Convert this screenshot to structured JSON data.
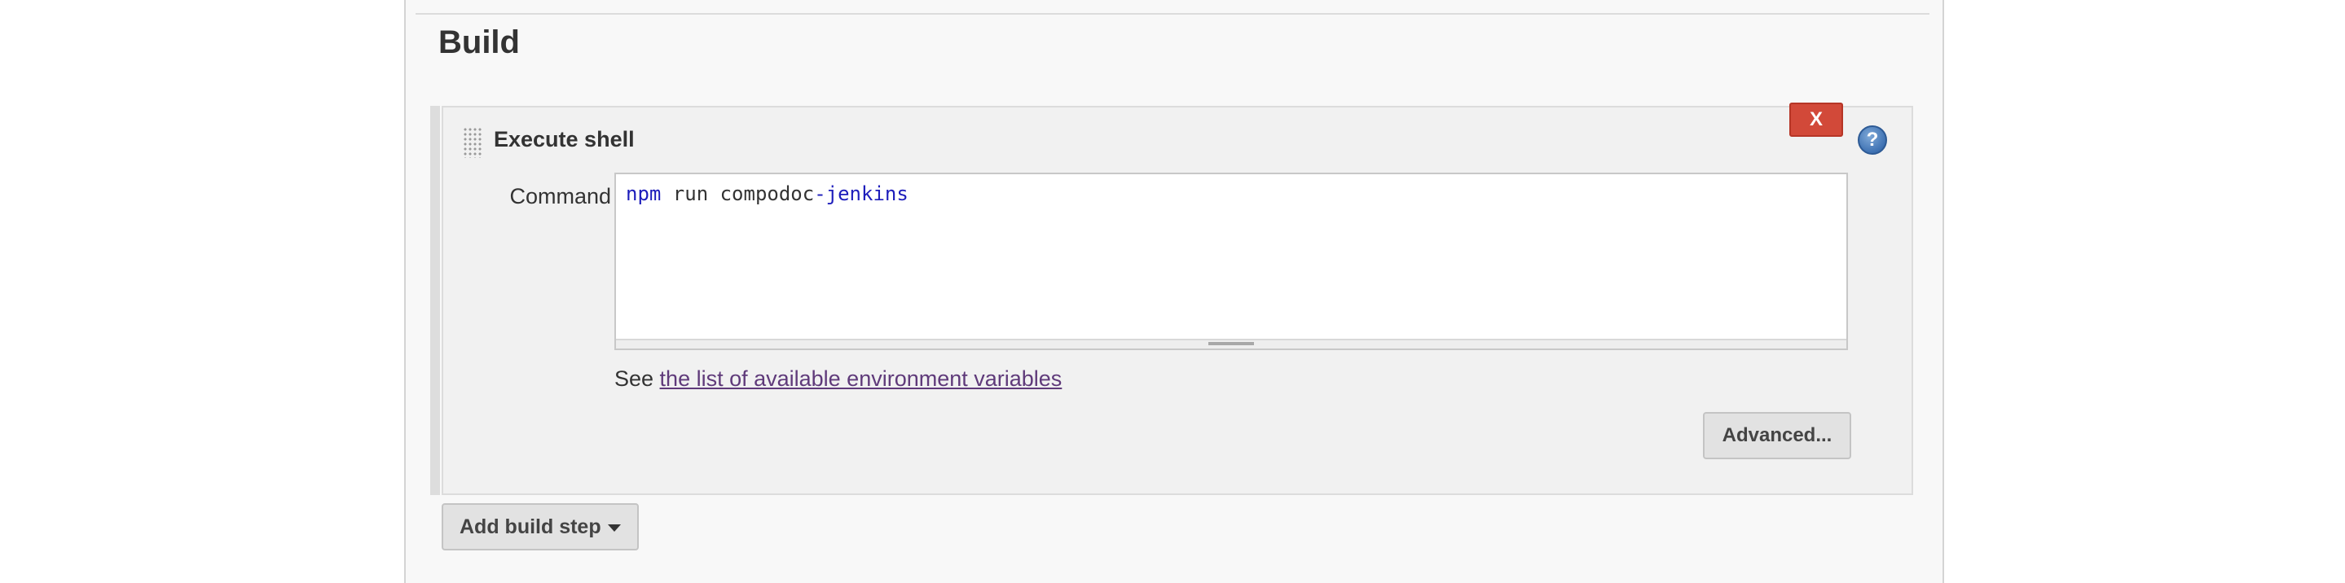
{
  "section": {
    "title": "Build"
  },
  "build_step": {
    "title": "Execute shell",
    "delete_label": "X",
    "help_label": "?",
    "command_label": "Command",
    "command_tokens": [
      {
        "text": "npm",
        "kind": "keyword"
      },
      {
        "text": " run compodoc",
        "kind": "plain"
      },
      {
        "text": "-jenkins",
        "kind": "keyword"
      }
    ],
    "env_hint_prefix": "See ",
    "env_link_text": "the list of available environment variables",
    "advanced_label": "Advanced..."
  },
  "footer": {
    "add_step_label": "Add build step"
  },
  "colors": {
    "delete_button": "#d24939",
    "link": "#5f3a7a",
    "code_keyword": "#1d1dbb"
  }
}
